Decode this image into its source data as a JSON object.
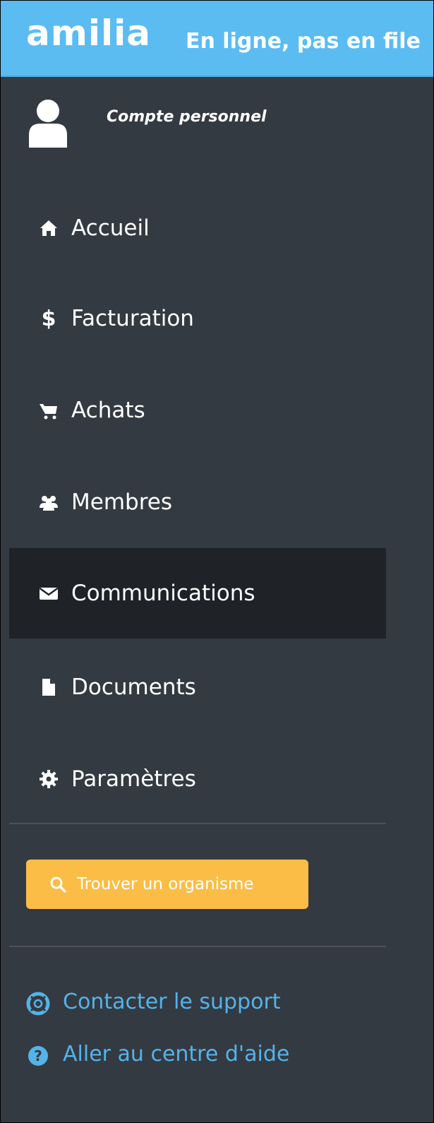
{
  "header": {
    "brand": "amilia",
    "tagline": "En ligne, pas en file"
  },
  "account": {
    "label": "Compte personnel",
    "icon": "user-icon"
  },
  "nav": {
    "items": [
      {
        "label": "Accueil",
        "icon": "home-icon",
        "active": false
      },
      {
        "label": "Facturation",
        "icon": "dollar-icon",
        "active": false
      },
      {
        "label": "Achats",
        "icon": "cart-icon",
        "active": false
      },
      {
        "label": "Membres",
        "icon": "users-icon",
        "active": false
      },
      {
        "label": "Communications",
        "icon": "envelope-icon",
        "active": true
      },
      {
        "label": "Documents",
        "icon": "file-icon",
        "active": false
      },
      {
        "label": "Paramètres",
        "icon": "gear-icon",
        "active": false
      }
    ]
  },
  "find_button": {
    "label": "Trouver un organisme",
    "icon": "search-icon"
  },
  "links": {
    "support": {
      "label": "Contacter le support",
      "icon": "lifebuoy-icon"
    },
    "help": {
      "label": "Aller au centre d'aide",
      "icon": "question-circle-icon"
    }
  },
  "colors": {
    "header": "#5bbcf2",
    "sidebar": "#343a41",
    "active_item": "#1f2227",
    "button": "#fbbd45",
    "link": "#53b4ea"
  }
}
